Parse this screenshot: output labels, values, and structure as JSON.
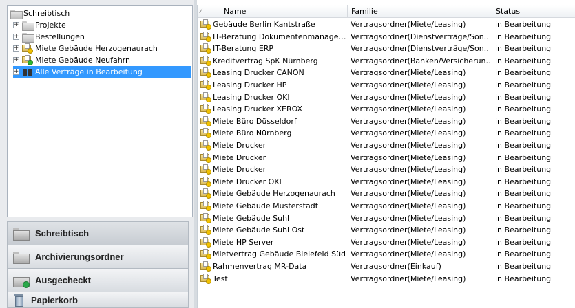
{
  "tree": {
    "root": {
      "label": "Schreibtisch",
      "icon": "folder-icon"
    },
    "items": [
      {
        "label": "Projekte",
        "icon": "folder-icon",
        "expander": "+"
      },
      {
        "label": "Bestellungen",
        "icon": "folder-icon",
        "expander": "+"
      },
      {
        "label": "Miete Gebäude Herzogenaurach",
        "icon": "contract-folder-icon",
        "expander": "+"
      },
      {
        "label": "Miete Gebäude Neufahrn",
        "icon": "contract-folder-icon",
        "expander": "+"
      },
      {
        "label": "Alle Verträge in Bearbeitung",
        "icon": "binoculars-icon",
        "expander": "+",
        "selected": true
      }
    ]
  },
  "nav": [
    {
      "label": "Schreibtisch",
      "icon": "desk-folder-icon",
      "active": true
    },
    {
      "label": "Archivierungsordner",
      "icon": "archive-folder-icon"
    },
    {
      "label": "Ausgecheckt",
      "icon": "checked-out-icon"
    },
    {
      "label": "Papierkorb",
      "icon": "trash-icon"
    }
  ],
  "list": {
    "columns": {
      "name": "Name",
      "family": "Familie",
      "status": "Status"
    },
    "rows": [
      {
        "name": "Gebäude Berlin Kantstraße",
        "family": "Vertragsordner(Miete/Leasing)",
        "status": "in Bearbeitung"
      },
      {
        "name": "IT-Beratung Dokumentenmanage…",
        "family": "Vertragsordner(Dienstverträge/Son…",
        "status": "in Bearbeitung"
      },
      {
        "name": "IT-Beratung ERP",
        "family": "Vertragsordner(Dienstverträge/Son…",
        "status": "in Bearbeitung"
      },
      {
        "name": "Kreditvertrag SpK Nürnberg",
        "family": "Vertragsordner(Banken/Versicherun…",
        "status": "in Bearbeitung"
      },
      {
        "name": "Leasing Drucker CANON",
        "family": "Vertragsordner(Miete/Leasing)",
        "status": "in Bearbeitung"
      },
      {
        "name": "Leasing Drucker HP",
        "family": "Vertragsordner(Miete/Leasing)",
        "status": "in Bearbeitung"
      },
      {
        "name": "Leasing Drucker OKI",
        "family": "Vertragsordner(Miete/Leasing)",
        "status": "in Bearbeitung"
      },
      {
        "name": "Leasing Drucker XEROX",
        "family": "Vertragsordner(Miete/Leasing)",
        "status": "in Bearbeitung"
      },
      {
        "name": "Miete Büro Düsseldorf",
        "family": "Vertragsordner(Miete/Leasing)",
        "status": "in Bearbeitung"
      },
      {
        "name": "Miete Büro Nürnberg",
        "family": "Vertragsordner(Miete/Leasing)",
        "status": "in Bearbeitung"
      },
      {
        "name": "Miete Drucker",
        "family": "Vertragsordner(Miete/Leasing)",
        "status": "in Bearbeitung"
      },
      {
        "name": "Miete Drucker",
        "family": "Vertragsordner(Miete/Leasing)",
        "status": "in Bearbeitung"
      },
      {
        "name": "Miete Drucker",
        "family": "Vertragsordner(Miete/Leasing)",
        "status": "in Bearbeitung"
      },
      {
        "name": "Miete Drucker OKI",
        "family": "Vertragsordner(Miete/Leasing)",
        "status": "in Bearbeitung"
      },
      {
        "name": "Miete Gebäude Herzogenaurach",
        "family": "Vertragsordner(Miete/Leasing)",
        "status": "in Bearbeitung"
      },
      {
        "name": "Miete Gebäude Musterstadt",
        "family": "Vertragsordner(Miete/Leasing)",
        "status": "in Bearbeitung"
      },
      {
        "name": "Miete Gebäude Suhl",
        "family": "Vertragsordner(Miete/Leasing)",
        "status": "in Bearbeitung"
      },
      {
        "name": "Miete Gebäude Suhl Ost",
        "family": "Vertragsordner(Miete/Leasing)",
        "status": "in Bearbeitung"
      },
      {
        "name": "Miete HP Server",
        "family": "Vertragsordner(Miete/Leasing)",
        "status": "in Bearbeitung"
      },
      {
        "name": "Mietvertrag Gebäude Bielefeld Süd",
        "family": "Vertragsordner(Miete/Leasing)",
        "status": "in Bearbeitung"
      },
      {
        "name": "Rahmenvertrag MR-Data",
        "family": "Vertragsordner(Einkauf)",
        "status": "in Bearbeitung"
      },
      {
        "name": "Test",
        "family": "Vertragsordner(Miete/Leasing)",
        "status": "in Bearbeitung"
      }
    ]
  }
}
